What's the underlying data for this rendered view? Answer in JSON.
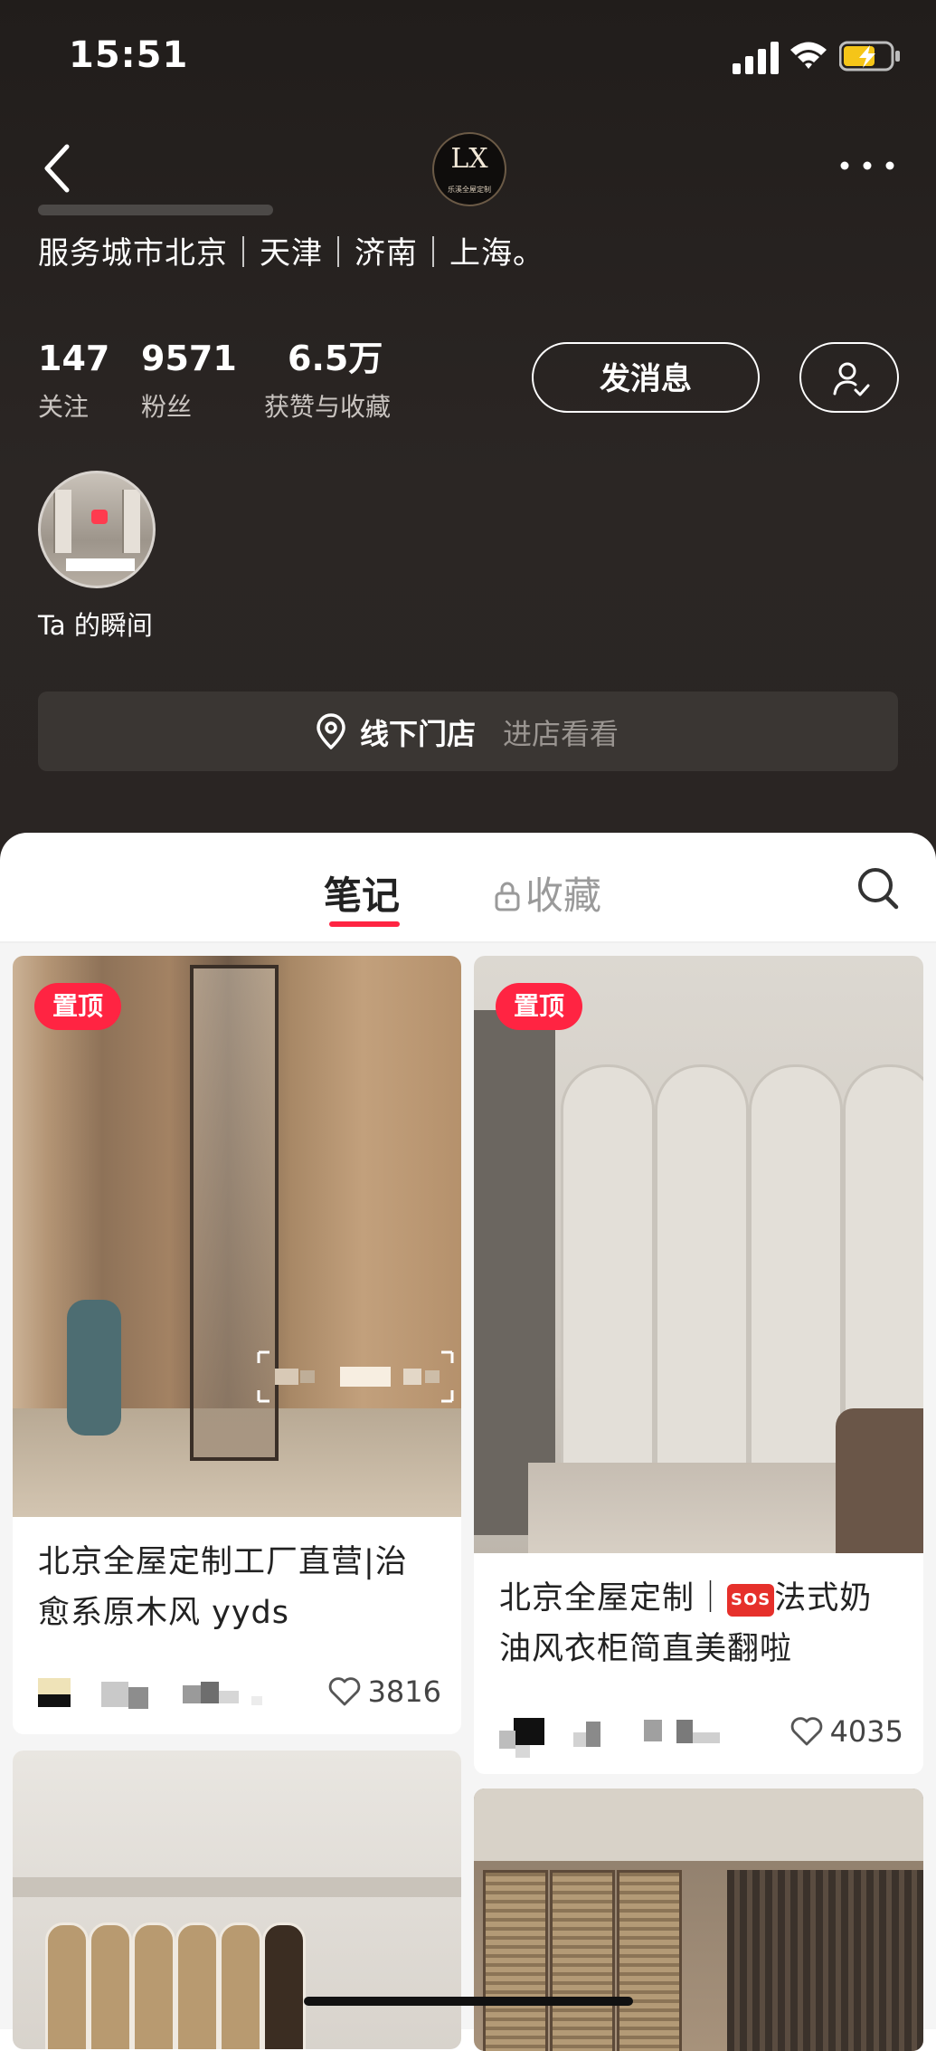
{
  "status_bar": {
    "time": "15:51"
  },
  "profile": {
    "logo_monogram": "LX",
    "logo_caption": "乐溪全屋定制",
    "bio_line": "服务城市北京｜天津｜济南｜上海。",
    "stats": [
      {
        "value": "147",
        "label": "关注"
      },
      {
        "value": "9571",
        "label": "粉丝"
      },
      {
        "value": "6.5万",
        "label": "获赞与收藏"
      }
    ],
    "message_button": "发消息",
    "moment_label": "Ta 的瞬间",
    "store": {
      "label": "线下门店",
      "action": "进店看看"
    }
  },
  "tabs": {
    "notes": "笔记",
    "collections": "收藏"
  },
  "notes": [
    {
      "pinned_label": "置顶",
      "title": "北京全屋定制工厂直营|治愈系原木风 yyds",
      "likes": "3816"
    },
    {
      "pinned_label": "置顶",
      "title_prefix": "北京全屋定制｜",
      "sos": "SOS",
      "title_suffix": "法式奶油风衣柜简直美翻啦",
      "likes": "4035"
    }
  ],
  "colors": {
    "accent": "#ff2442",
    "header_bg": "#2a2523",
    "store_bg": "#3a3633"
  }
}
